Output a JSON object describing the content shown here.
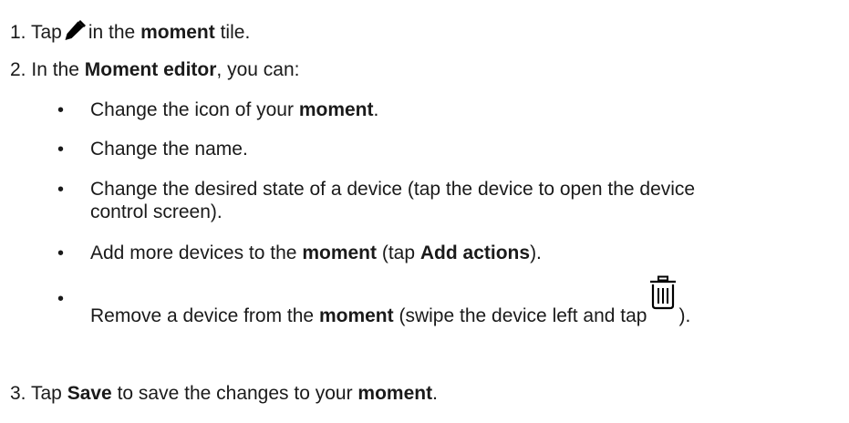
{
  "step1": {
    "number": "1.",
    "before_icon": "Tap",
    "icon": "pencil-icon",
    "after_icon": "in the",
    "bold": "moment",
    "tail": "tile."
  },
  "step2": {
    "number": "2.",
    "before": "In the",
    "bold": "Moment editor",
    "tail": ", you can:"
  },
  "bullets": [
    {
      "bullet": "•",
      "before": "Change the icon of your",
      "bold": "moment",
      "tail": "."
    },
    {
      "bullet": "•",
      "text": "Change the name."
    },
    {
      "bullet": "•",
      "line1": "Change the desired state of a device (tap the device to open the device",
      "line2": "control screen)."
    },
    {
      "bullet": "•",
      "before": "Add more devices to the",
      "bold": "moment",
      "middle": "(tap",
      "bold2": "Add actions",
      "tail": ")."
    },
    {
      "bullet": "•",
      "before": "Remove a device from the",
      "bold": "moment",
      "middle": "(swipe the device left and tap",
      "icon": "trash-icon",
      "tail": ")."
    }
  ],
  "step3": {
    "number": "3.",
    "before": "Tap",
    "bold": "Save",
    "middle": "to save the changes to your",
    "bold2": "moment",
    "tail": "."
  }
}
